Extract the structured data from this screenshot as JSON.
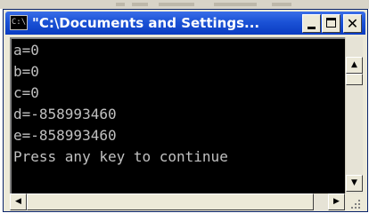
{
  "window": {
    "title": "\"C:\\Documents and Settings...",
    "icon": "console-icon",
    "icon_glyph": "C:\\"
  },
  "console": {
    "lines": [
      "a=0",
      "b=0",
      "c=0",
      "d=-858993460",
      "e=-858993460",
      "Press any key to continue"
    ],
    "foreground": "#c0c0c0",
    "background": "#000000"
  },
  "caption_buttons": {
    "minimize": "minimize-icon",
    "maximize": "maximize-icon",
    "close": "close-icon",
    "close_glyph": "✕"
  },
  "scrollbars": {
    "up_glyph": "▲",
    "down_glyph": "▼",
    "left_glyph": "◀",
    "right_glyph": "▶"
  }
}
